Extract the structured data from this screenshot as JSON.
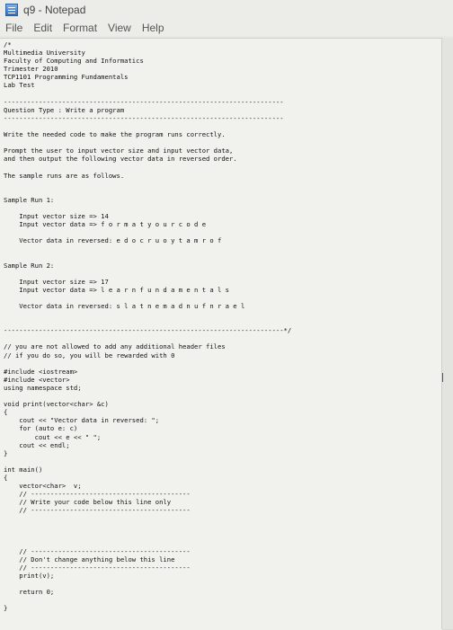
{
  "window": {
    "title": "q9 - Notepad",
    "menu": [
      "File",
      "Edit",
      "Format",
      "View",
      "Help"
    ]
  },
  "editor": {
    "lines": [
      "/*",
      "Multimedia University",
      "Faculty of Computing and Informatics",
      "Trimester 2010",
      "TCP1101 Programming Fundamentals",
      "Lab Test",
      "",
      "------------------------------------------------------------------------",
      "Question Type : Write a program",
      "------------------------------------------------------------------------",
      "",
      "Write the needed code to make the program runs correctly.",
      "",
      "Prompt the user to input vector size and input vector data,",
      "and then output the following vector data in reversed order.",
      "",
      "The sample runs are as follows.",
      "",
      "",
      "Sample Run 1:",
      "",
      "    Input vector size => 14",
      "    Input vector data => f o r m a t y o u r c o d e",
      "",
      "    Vector data in reversed: e d o c r u o y t a m r o f",
      "",
      "",
      "Sample Run 2:",
      "",
      "    Input vector size => 17",
      "    Input vector data => l e a r n f u n d a m e n t a l s",
      "",
      "    Vector data in reversed: s l a t n e m a d n u f n r a e l",
      "",
      "",
      "------------------------------------------------------------------------*/",
      "",
      "// you are not allowed to add any additional header files",
      "// if you do so, you will be rewarded with 0",
      "",
      "#include <iostream>",
      "#include <vector>",
      "using namespace std;",
      "",
      "void print(vector<char> &c)",
      "{",
      "    cout << \"Vector data in reversed: \";",
      "    for (auto e: c)",
      "        cout << e << \" \";",
      "    cout << endl;",
      "}",
      "",
      "int main()",
      "{",
      "    vector<char>  v;",
      "    // -----------------------------------------",
      "    // Write your code below this line only",
      "    // -----------------------------------------",
      "",
      "",
      "",
      "",
      "    // -----------------------------------------",
      "    // Don't change anything below this line",
      "    // -----------------------------------------",
      "    print(v);",
      "",
      "    return 0;",
      "",
      "}"
    ]
  }
}
